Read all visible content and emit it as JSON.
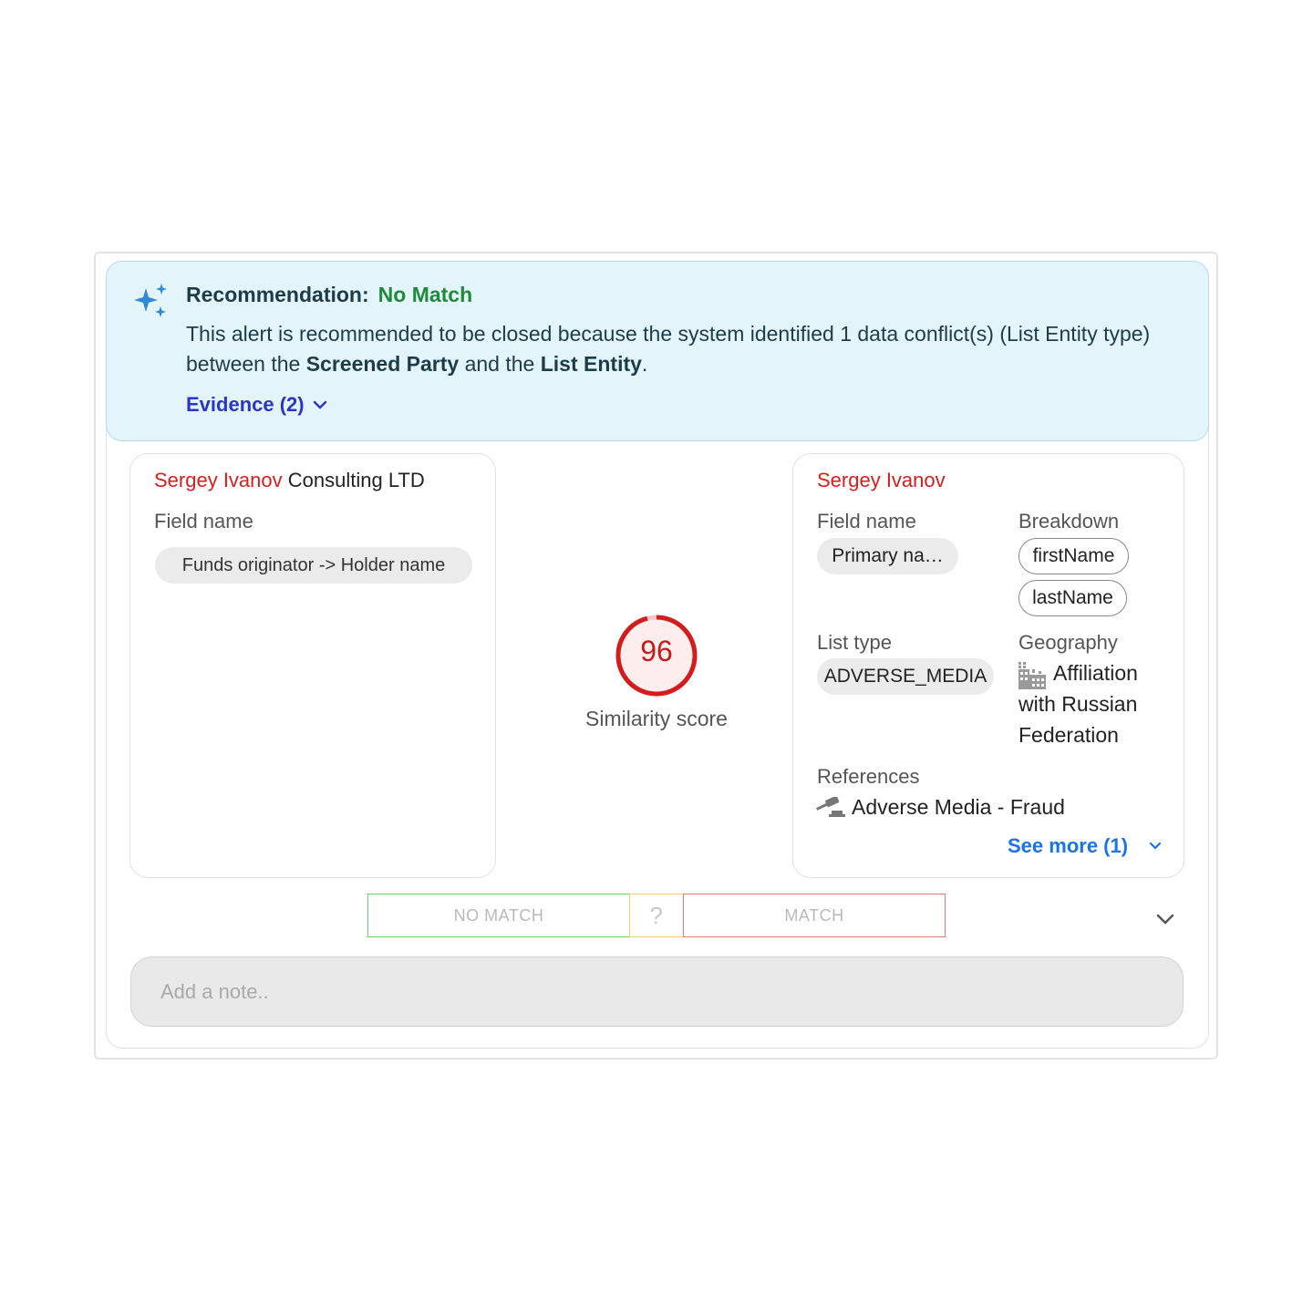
{
  "colors": {
    "accent_blue": "#2a36c7",
    "link_blue": "#1a73e8",
    "status_green": "#1e8a3a",
    "name_red": "#d61f1f",
    "score_red": "#c91a1a",
    "banner_bg": "#e3f4fa"
  },
  "recommendation": {
    "icon": "sparkle-icon",
    "label": "Recommendation:",
    "status": "No Match",
    "text_prefix": "This alert is recommended to be closed because the system identified 1 data conflict(s) (List Entity type) between the ",
    "bold1": "Screened Party",
    "text_mid": " and the ",
    "bold2": "List Entity",
    "text_suffix": ".",
    "evidence_label": "Evidence (2)"
  },
  "screened_party": {
    "name_highlight": "Sergey Ivanov",
    "name_rest": " Consulting LTD",
    "field_label": "Field name",
    "field_value": "Funds originator -> Holder name"
  },
  "score": {
    "value": "96",
    "fraction": 0.96,
    "label": "Similarity score"
  },
  "list_entity": {
    "name": "Sergey Ivanov",
    "field_label": "Field name",
    "field_value": "Primary na…",
    "breakdown_label": "Breakdown",
    "breakdown": [
      "firstName",
      "lastName"
    ],
    "list_type_label": "List type",
    "list_type_value": "ADVERSE_MEDIA",
    "geography_label": "Geography",
    "geography_icon": "building-icon",
    "geography_value": [
      "Affiliation",
      "with Russian",
      "Federation"
    ],
    "references_label": "References",
    "references_icon": "gavel-icon",
    "reference_value": "Adverse Media - Fraud",
    "see_more": "See more (1)"
  },
  "decision": {
    "no_match": "NO MATCH",
    "unsure": "?",
    "match": "MATCH"
  },
  "note": {
    "placeholder": "Add a note.."
  }
}
